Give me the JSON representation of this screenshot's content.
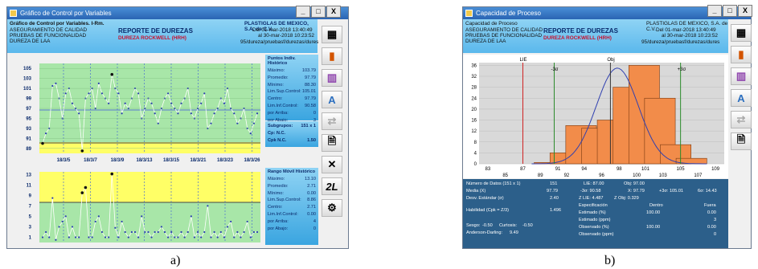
{
  "window_a": {
    "title": "Gráfico de Control por Variables",
    "header": {
      "line1": "Gráfico de Control por Variables. I-Rm.",
      "line2": "ASEGURAMIENTO DE CALIDAD",
      "line3": "PRUEBAS DE FUNCIONALIDAD",
      "line4": "DUREZA DE LAA",
      "report_title": "REPORTE DE DUREZAS",
      "report_subtitle": "DUREZA ROCKWELL (HRH)",
      "company": "PLASTIGLAS DE MEXICO, S.A. de C.V.",
      "date_from": "Del  01-mar-2018  13:40:49",
      "date_to": "al  30-mar-2018  10:23:52",
      "path": "95/dureza/pruebasf/durezas/dures"
    },
    "indiv_panel": {
      "title": "Puntos Indiv. Histórico",
      "rows": [
        {
          "label": "Máximo:",
          "value": "103.79"
        },
        {
          "label": "Promedio:",
          "value": "97.79"
        },
        {
          "label": "Mínimo:",
          "value": "88.30"
        },
        {
          "label": "Lim.Sup.Control:",
          "value": "105.01"
        },
        {
          "label": "Centro:",
          "value": "97.79"
        },
        {
          "label": "Lim.Inf.Control:",
          "value": "90.58"
        },
        {
          "label": "por Arriba:",
          "value": "0"
        },
        {
          "label": "por Abajo:",
          "value": "3"
        }
      ]
    },
    "cap_panel": {
      "rows": [
        {
          "label": "Subgrupos:",
          "value": "151 x 1"
        },
        {
          "label": "Cp: N.C.",
          "value": ""
        },
        {
          "label": "Cpk N.C.",
          "value": "1.50"
        }
      ]
    },
    "range_panel": {
      "title": "Rango Móvil Histórico",
      "rows": [
        {
          "label": "Máximo:",
          "value": "13.10"
        },
        {
          "label": "Promedio:",
          "value": "2.71"
        },
        {
          "label": "Mínimo:",
          "value": "0.00"
        },
        {
          "label": "Lim.Sup.Control:",
          "value": "8.86"
        },
        {
          "label": "Centro:",
          "value": "2.71"
        },
        {
          "label": "Lim.Inf.Control:",
          "value": "0.00"
        },
        {
          "label": "por Arriba:",
          "value": "4"
        },
        {
          "label": "por Abajo:",
          "value": "0"
        }
      ]
    },
    "x_ticks": [
      "18/3/5",
      "18/3/7",
      "18/3/9",
      "18/3/13",
      "18/3/15",
      "18/3/21",
      "18/3/23",
      "18/3/26"
    ],
    "indiv_y_ticks": [
      "105",
      "103",
      "101",
      "99",
      "97",
      "95",
      "93",
      "91",
      "89"
    ],
    "range_y_ticks": [
      "13",
      "11",
      "9",
      "7",
      "5",
      "3",
      "1"
    ],
    "caption": "a)"
  },
  "window_b": {
    "title": "Capacidad de Proceso",
    "header": {
      "line1": "Capacidad de Proceso",
      "line2": "ASEGURAMIENTO DE CALIDAD",
      "line3": "PRUEBAS DE FUNCIONALIDAD",
      "line4": "DUREZA DE LAA",
      "report_title": "REPORTE DE DUREZAS",
      "report_subtitle": "DUREZA ROCKWELL (HRH)",
      "company": "PLASTIGLAS DE MEXICO, S.A. de C.V.",
      "date_from": "Del  01-mar-2018  13:40:49",
      "date_to": "al  30-mar-2018  10:23:52",
      "path": "95/dureza/pruebasf/durezas/dures"
    },
    "chart_labels": {
      "lie": "LIE",
      "obj": "Obj",
      "minus3s": "-3σ",
      "plus3s": "+3σ"
    },
    "stats": {
      "n_label": "Número de Datos  (151 x 1)",
      "n_value": "151",
      "mean_label": "Media (X)",
      "mean_value": "97.79",
      "sd_label": "Desv. Estándar (σ)",
      "sd_value": "2.40",
      "lie": "LIE: 87.00",
      "obj": "Obj: 97.00",
      "m3s": "-3σ: 90.58",
      "xbar": "X: 97.79",
      "p3s": "+3σ: 105.01",
      "six_s": "6σ: 14.43",
      "zlie": "Z LIE: 4.487",
      "zobj": "Z Obj: 0.329",
      "hab_label": "Habilidad (Cpk = Z/3)",
      "hab_value": "1.496",
      "col_spec": "Especificación",
      "col_in": "Dentro",
      "col_out": "Fuera",
      "est_pct": "Estimado (%)",
      "est_pct_in": "100.00",
      "est_pct_out": "0.00",
      "est_ppm": "Estimado (ppm)",
      "est_ppm_out": "3",
      "obs_pct": "Observado (%)",
      "obs_pct_in": "100.00",
      "obs_pct_out": "0.00",
      "obs_ppm": "Observado (ppm)",
      "obs_ppm_out": "0",
      "sesgo": "Sesgo:",
      "sesgo_v": "-0.50",
      "curt": "Curtosis:",
      "curt_v": "-0.50",
      "ad": "Anderson-Darling:",
      "ad_v": "9.49"
    },
    "caption": "b)"
  },
  "window_buttons": {
    "min": "_",
    "max": "□",
    "close": "X"
  },
  "chart_data": [
    {
      "type": "line",
      "title": "Puntos Individuales",
      "ylim": [
        88,
        106
      ],
      "x_categories": [
        "18/3/5",
        "18/3/7",
        "18/3/9",
        "18/3/13",
        "18/3/15",
        "18/3/21",
        "18/3/23",
        "18/3/26"
      ],
      "reference_lines": {
        "ucl": 105.01,
        "center": 97.79,
        "lcl": 90.58
      },
      "series": [
        {
          "values": [
            90,
            92,
            93,
            101.5,
            102,
            99,
            95,
            100,
            101,
            98,
            97,
            96,
            88.5,
            99,
            100,
            101,
            97,
            102,
            100,
            99,
            98,
            103.8,
            101,
            100,
            96,
            98,
            97,
            99,
            101,
            100,
            95,
            97,
            99,
            98,
            96,
            94,
            97,
            99,
            100,
            98,
            97,
            96,
            98,
            99,
            101,
            96,
            95,
            97,
            98,
            100,
            93,
            94,
            96,
            97,
            99,
            98,
            101,
            97,
            96,
            94,
            95,
            97,
            93,
            92,
            94,
            96
          ]
        }
      ]
    },
    {
      "type": "line",
      "title": "Rango Móvil",
      "ylim": [
        0,
        13.5
      ],
      "x_categories": [
        "18/3/5",
        "18/3/7",
        "18/3/9",
        "18/3/13",
        "18/3/15",
        "18/3/21",
        "18/3/23",
        "18/3/26"
      ],
      "reference_lines": {
        "ucl": 8.86,
        "center": 2.71,
        "lcl": 0
      },
      "series": [
        {
          "values": [
            1,
            2,
            1,
            8.5,
            0.5,
            3,
            4,
            5,
            1,
            3,
            1,
            1,
            9.5,
            10.5,
            1,
            1,
            4,
            5,
            2,
            1,
            1,
            13.1,
            2.8,
            1,
            4,
            2,
            1,
            2,
            2,
            1,
            5,
            2,
            2,
            1,
            2,
            2,
            3,
            2,
            1,
            2,
            1,
            1,
            2,
            1,
            2,
            5,
            1,
            2,
            1,
            2,
            7,
            1,
            2,
            1,
            2,
            1,
            3,
            4,
            1,
            2,
            1,
            2,
            4,
            1,
            2,
            2
          ]
        }
      ]
    },
    {
      "type": "bar",
      "title": "Capacidad de Proceso",
      "categories": [
        "87",
        "89",
        "91",
        "92",
        "94",
        "96",
        "98",
        "100",
        "101",
        "103",
        "105",
        "107",
        "109"
      ],
      "values": [
        0,
        0.5,
        4,
        14,
        13,
        16,
        28,
        36,
        24,
        7,
        2,
        0,
        0
      ],
      "ylim": [
        0,
        37
      ],
      "y_ticks": [
        "36",
        "32",
        "28",
        "24",
        "20",
        "16",
        "12",
        "8",
        "4",
        "0"
      ],
      "x_ticks_upper": [
        "83",
        "87",
        "91",
        "94",
        "98",
        "101",
        "105",
        "109"
      ],
      "x_ticks_lower": [
        "85",
        "89",
        "92",
        "96",
        "100",
        "103",
        "107"
      ]
    }
  ]
}
